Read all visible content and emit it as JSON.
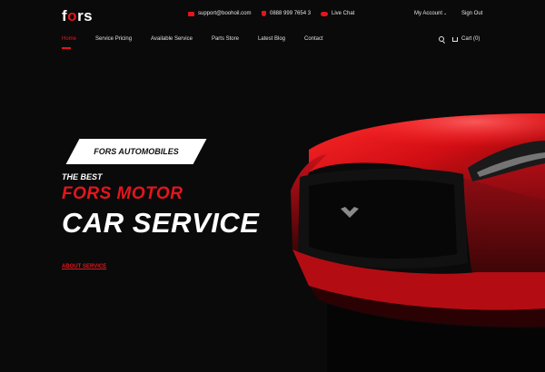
{
  "brand": {
    "logo_left": "f",
    "logo_mid": "o",
    "logo_right": "rs"
  },
  "topbar": {
    "email": "support@boohoil.com",
    "phone": "0888 999 7654 3",
    "live_chat": "Live Chat",
    "my_account": "My Account",
    "sign_out": "Sign Out"
  },
  "nav": {
    "items": [
      "Home",
      "Service Pricing",
      "Available Service",
      "Parts Store",
      "Latest Blog",
      "Contact"
    ],
    "active_index": 0,
    "cart": "Cart (0)"
  },
  "hero": {
    "badge": "FORS AUTOMOBILES",
    "subtitle": "THE BEST",
    "title_red": "FORS MOTOR",
    "title_white": "CAR SERVICE",
    "link": "ABOUT SERVICE"
  },
  "colors": {
    "accent": "#e3161d",
    "background": "#0a0a0a",
    "text": "#ffffff"
  },
  "icons": [
    "envelope-icon",
    "phone-icon",
    "chat-icon",
    "search-icon",
    "cart-icon"
  ]
}
